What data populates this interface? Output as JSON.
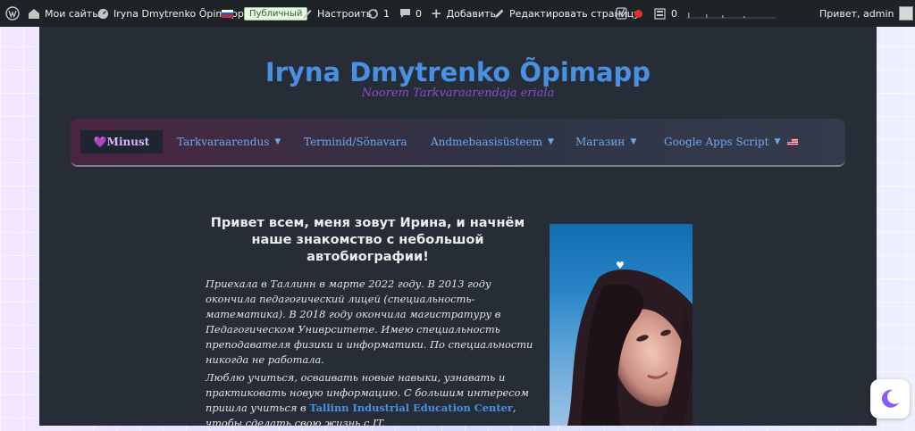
{
  "adminbar": {
    "my_sites": "Мои сайты",
    "site_name": "Iryna Dmytrenko Õpimapp",
    "public_badge": "Публичный",
    "customize": "Настроить",
    "updates_count": "1",
    "comments_count": "0",
    "add_new": "Добавить",
    "edit_page": "Редактировать страницу",
    "stats_count": "0",
    "greeting": "Привет, admin"
  },
  "site": {
    "title": "Iryna Dmytrenko Õpimapp",
    "tagline": "Noorem Tarkvaraarendaja eriala"
  },
  "nav": {
    "items": [
      {
        "label": "💜Minust",
        "dropdown": false
      },
      {
        "label": "Tarkvaraarendus",
        "dropdown": true
      },
      {
        "label": "Terminid/Sõnavara",
        "dropdown": false
      },
      {
        "label": "Andmebaasisüsteem",
        "dropdown": true
      },
      {
        "label": "Магазин",
        "dropdown": true
      },
      {
        "label": "Google Apps Script",
        "dropdown": true
      }
    ],
    "language_flag": "en-US-flag-icon"
  },
  "content": {
    "heading": "Привет всем, меня зовут Ирина, и начнём наше знакомство с небольшой автобиографии!",
    "paragraph1": "Приехала в Таллинн в марте 2022 году. В 2013 году окончила педагогический лицей (специальность- математика). В 2018 году окончила магистратуру в Педагогическом Униврситете. Имею специальность преподавателя физики и информатики. По специальности никогда не работала.",
    "paragraph2_before": "Люблю учиться, осваивать новые навыки, узнавать и практиковать новую информацию. С большим интересом пришла учиться в ",
    "paragraph2_link": "Tallinn Industrial Education Center",
    "paragraph2_after": ", чтобы сделать свою жизнь с IT.",
    "photo_icon": "heart-icon"
  },
  "colors": {
    "accent": "#4a90e2",
    "tagline": "#8e4ad0",
    "page_bg": "#262d37",
    "adminbar_bg": "#1d2327"
  }
}
